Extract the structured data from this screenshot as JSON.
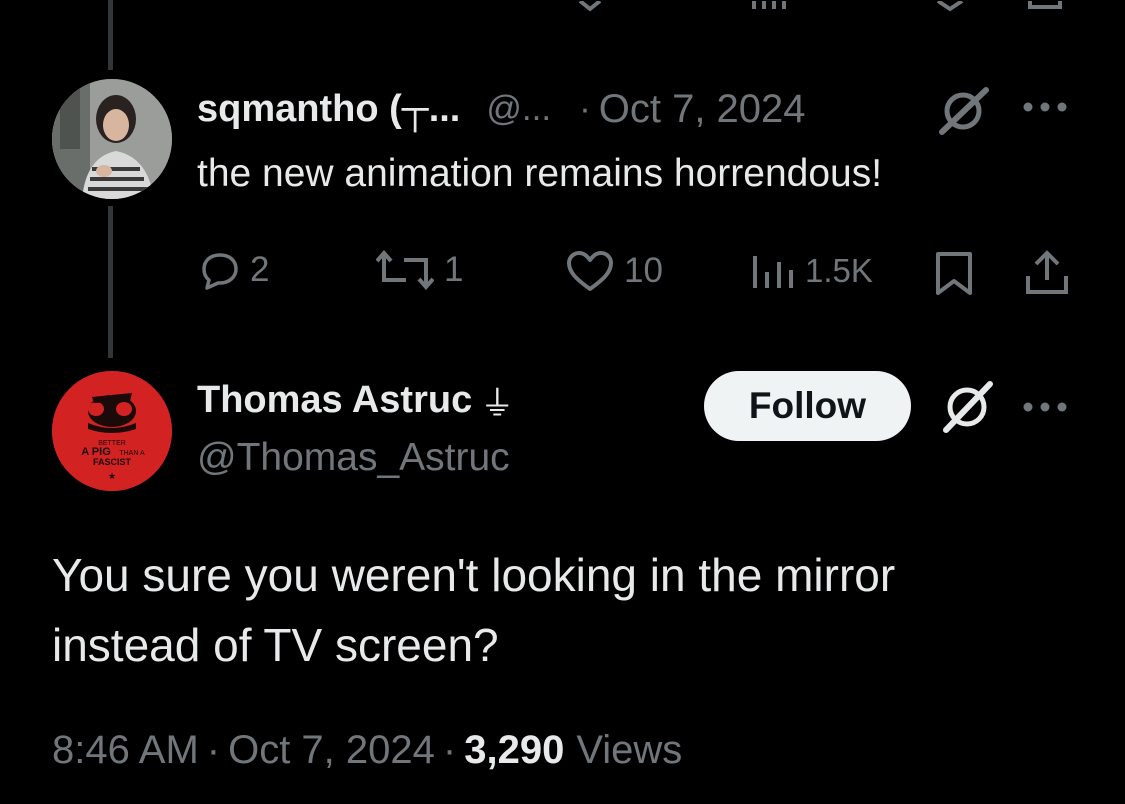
{
  "parent_tweet": {
    "display_name": "sqmantho (┬...",
    "handle": "@...",
    "separator": "·",
    "date": "Oct 7, 2024",
    "text": "the new animation remains horrendous!",
    "actions": {
      "replies": "2",
      "reposts": "1",
      "likes": "10",
      "views": "1.5K"
    },
    "icons": [
      "grok-icon",
      "more-icon",
      "reply-icon",
      "repost-icon",
      "like-icon",
      "views-icon",
      "bookmark-icon",
      "share-icon"
    ]
  },
  "main_tweet": {
    "display_name": "Thomas Astruc",
    "badge_glyph": "⏚",
    "handle": "@Thomas_Astruc",
    "follow_label": "Follow",
    "avatar_text": {
      "line1": "BETTER",
      "line2": "A PIG",
      "line2b": "THAN A",
      "line3": "FASCIST",
      "star": "★"
    },
    "text_line1": "You sure you weren't looking in the mirror",
    "text_line2": "instead of TV screen?",
    "time": "8:46 AM",
    "dot": "·",
    "date": "Oct 7, 2024",
    "views_count": "3,290",
    "views_label": "Views",
    "colors": {
      "avatar_bg": "#d32222",
      "follow_bg": "#eff3f4"
    }
  }
}
